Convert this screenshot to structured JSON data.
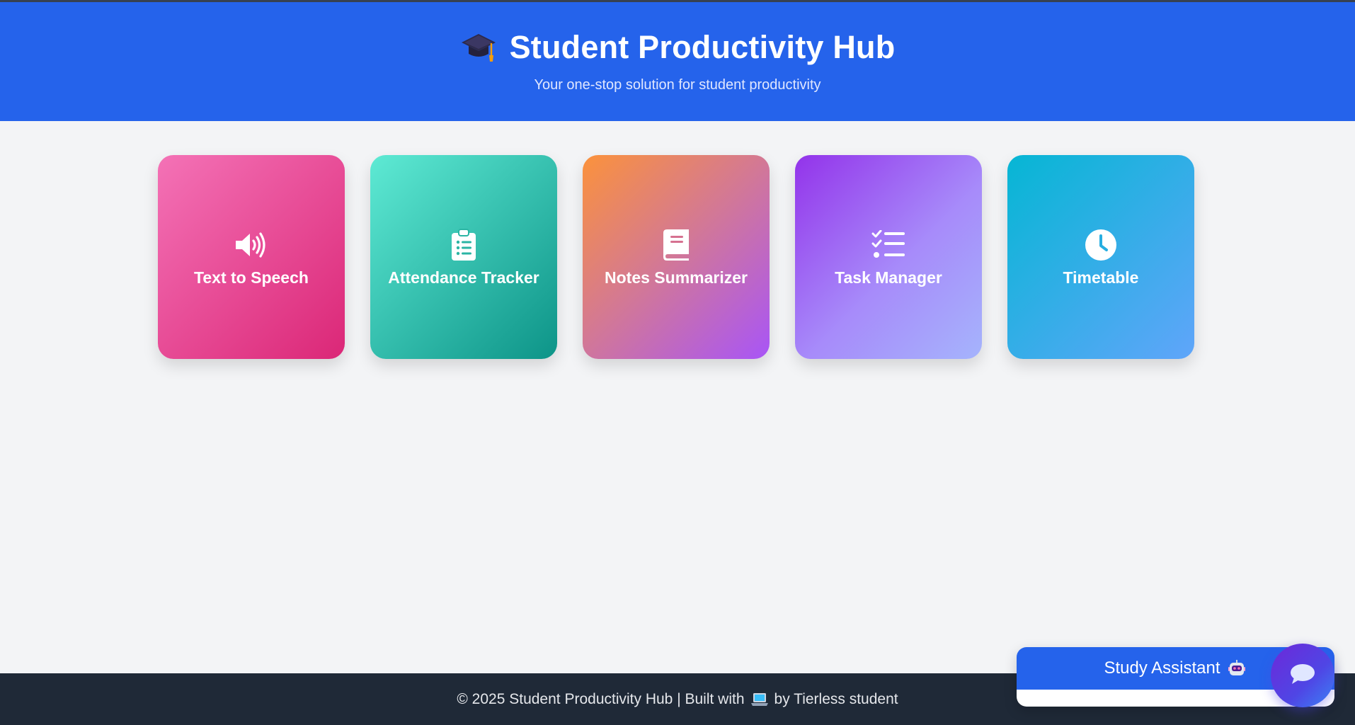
{
  "header": {
    "title": "Student Productivity Hub",
    "subtitle": "Your one-stop solution for student productivity",
    "title_icon": "graduation-cap-icon",
    "background": "#2563eb"
  },
  "cards": [
    {
      "label": "Text to Speech",
      "icon": "speaker-icon",
      "colors": [
        "#f472b6",
        "#db2777"
      ]
    },
    {
      "label": "Attendance Tracker",
      "icon": "clipboard-list-icon",
      "colors": [
        "#5eead4",
        "#0d9488"
      ]
    },
    {
      "label": "Notes Summarizer",
      "icon": "book-icon",
      "colors": [
        "#fb923c",
        "#a855f7"
      ]
    },
    {
      "label": "Task Manager",
      "icon": "checklist-icon",
      "colors": [
        "#9333ea",
        "#a5b4fc"
      ]
    },
    {
      "label": "Timetable",
      "icon": "clock-icon",
      "colors": [
        "#06b6d4",
        "#60a5fa"
      ]
    }
  ],
  "footer": {
    "text_before": "© 2025 Student Productivity Hub | Built with",
    "text_after": "by Tierless student",
    "icon": "laptop-icon",
    "background": "#1f2937"
  },
  "assistant": {
    "title": "Study Assistant",
    "title_icon": "robot-icon",
    "fab_icon": "chat-bubble-icon"
  }
}
